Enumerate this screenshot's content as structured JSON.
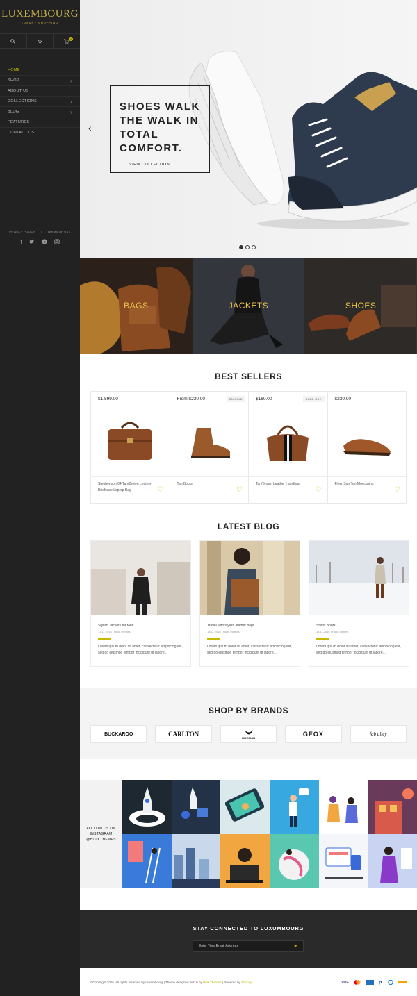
{
  "sidebar": {
    "logo": {
      "name": "LUXEMBOURG",
      "tagline": "LUXURY SHOPPING"
    },
    "cart_count": "0",
    "nav": [
      {
        "label": "HOME",
        "has_children": false
      },
      {
        "label": "SHOP",
        "has_children": true
      },
      {
        "label": "ABOUT US",
        "has_children": false
      },
      {
        "label": "COLLECTIONS",
        "has_children": true
      },
      {
        "label": "BLOG",
        "has_children": true
      },
      {
        "label": "FEATURES",
        "has_children": false
      },
      {
        "label": "CONTACT US",
        "has_children": false
      }
    ],
    "links": {
      "privacy": "PRIVACY POLICY",
      "sep": "|",
      "terms": "TERMS OF USE"
    },
    "social_icons": [
      "facebook-icon",
      "twitter-icon",
      "pinterest-icon",
      "instagram-icon"
    ]
  },
  "hero": {
    "title": "SHOES WALK THE WALK IN TOTAL COMFORT.",
    "cta": "VIEW COLLECTION",
    "slides": 3,
    "active_slide": 1
  },
  "categories": [
    {
      "label": "BAGS"
    },
    {
      "label": "JACKETS"
    },
    {
      "label": "SHOES"
    }
  ],
  "best_sellers": {
    "title": "BEST SELLERS",
    "products": [
      {
        "price": "$1,899.00",
        "badge": "",
        "name": "Stephenson 04 Tan/Brown Leather Briefcase Laptop Bag"
      },
      {
        "price": "From $230.00",
        "badge": "ON SALE",
        "name": "Tan Boots"
      },
      {
        "price": "$160.00",
        "badge": "SOLD OUT",
        "name": "Tan/Brown Leather Handbag"
      },
      {
        "price": "$230.00",
        "badge": "",
        "name": "Finer Sun Tan Moccasins"
      }
    ]
  },
  "latest_blog": {
    "title": "LATEST BLOG",
    "posts": [
      {
        "title": "Stylish Jackets for Men",
        "date": "13.11.2016",
        "sep": "|",
        "author": "Hulk Themes",
        "excerpt": "Lorem ipsum dolor sit amet, consectetur adipiscing elit, sed do eiusmod tempor incididunt ut labore..."
      },
      {
        "title": "Travel with stylish leather bags",
        "date": "13.11.2016",
        "sep": "|",
        "author": "Hulk Themes",
        "excerpt": "Lorem ipsum dolor sit amet, consectetur adipiscing elit, sed do eiusmod tempor incididunt ut labore..."
      },
      {
        "title": "Stylist Boots",
        "date": "13.11.2016",
        "sep": "|",
        "author": "Hulk Themes",
        "excerpt": "Lorem ipsum dolor sit amet, consectetur adipiscing elit, sed do eiusmod tempor incididunt ut labore..."
      }
    ]
  },
  "brands": {
    "title": "SHOP BY BRANDS",
    "items": [
      "BUCKAROO",
      "CARLTON",
      "HIDESIGN",
      "GEOX",
      "fab alley"
    ]
  },
  "instagram": {
    "label": "FOLLOW US ON INSTAGRAM @HULKTHEMES"
  },
  "newsletter": {
    "title": "STAY CONNECTED TO LUXUMBOURG",
    "placeholder": "Enter Your Email Address"
  },
  "footer": {
    "copyright": "©Copyright 2016. All rights reserved by Luxembourg",
    "sep1": "|",
    "designed_prefix": "Theme designed with",
    "designed_by": "by",
    "designer": "Hulk Themes",
    "sep2": "|",
    "powered": "Powered by",
    "platform": "Shopify",
    "payments": [
      "VISA",
      "MC",
      "AMEX",
      "P",
      "D",
      "DISC"
    ]
  },
  "colors": {
    "accent": "#c9b800",
    "sidebar": "#222222",
    "category_label": "#e6c34b"
  }
}
